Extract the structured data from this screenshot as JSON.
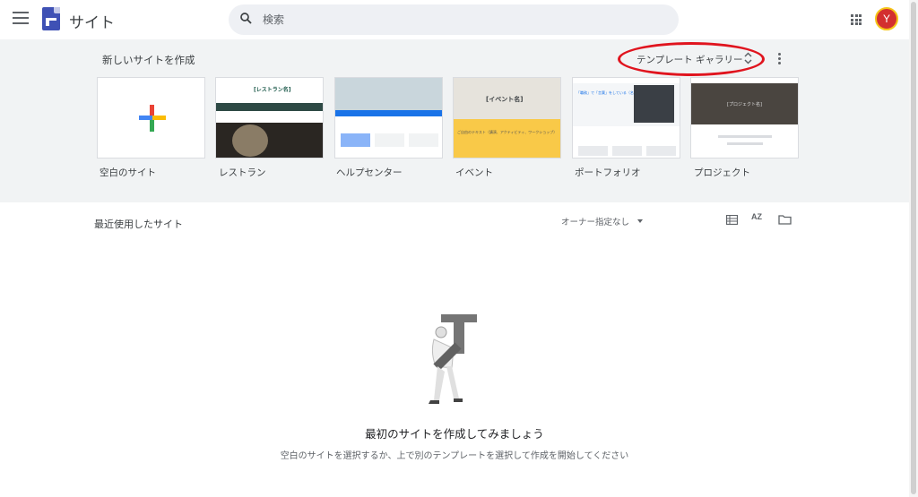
{
  "app": {
    "title": "サイト",
    "menu_icon": "hamburger-menu-icon",
    "logo_icon": "google-sites-logo-icon"
  },
  "search": {
    "placeholder": "検索",
    "icon": "search-icon"
  },
  "header_right": {
    "apps_icon": "apps-grid-icon",
    "avatar_letter": "Y"
  },
  "templates": {
    "section_title": "新しいサイトを作成",
    "gallery_label": "テンプレート ギャラリー",
    "items": [
      {
        "label": "空白のサイト"
      },
      {
        "label": "レストラン",
        "preview_heading": "[レストラン名]"
      },
      {
        "label": "ヘルプセンター"
      },
      {
        "label": "イベント",
        "preview_heading": "[イベント名]",
        "preview_text": "ご自由のテキスト（講演、アクティビティ、ワークショップ）"
      },
      {
        "label": "ポートフォリオ",
        "preview_heading": "「職務」で「言葉」をしている（名前）です。"
      },
      {
        "label": "プロジェクト",
        "preview_heading": "[プロジェクト名]"
      }
    ],
    "annotation_color": "#e0141e"
  },
  "recent": {
    "title": "最近使用したサイト",
    "owner_filter": "オーナー指定なし",
    "sort_label": "AZ",
    "empty_title": "最初のサイトを作成してみましょう",
    "empty_subtitle": "空白のサイトを選択するか、上で別のテンプレートを選択して作成を開始してください"
  },
  "colors": {
    "brand": "#3f51b5",
    "avatar": "#d32f2f",
    "band": "#f1f3f4"
  }
}
